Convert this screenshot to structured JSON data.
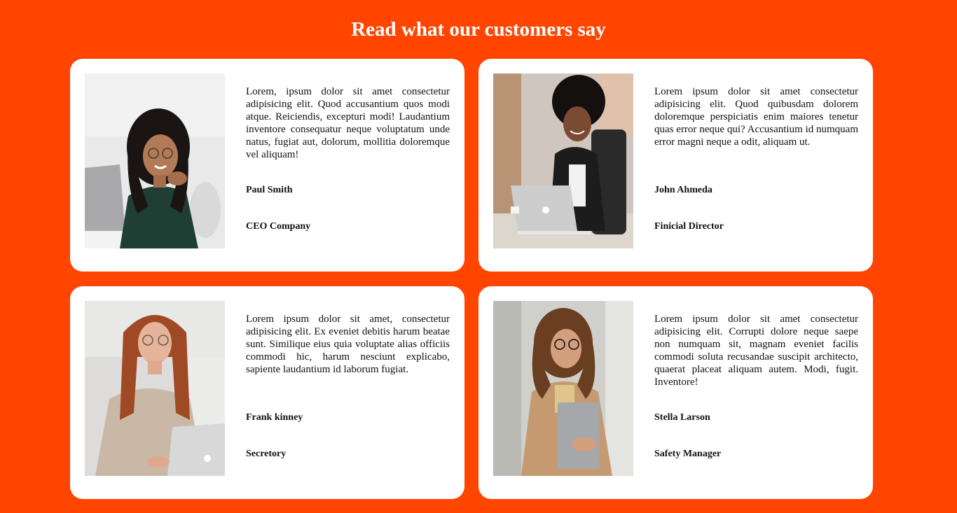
{
  "page": {
    "heading": "Read what our customers say",
    "background_color": "#ff4500"
  },
  "testimonials": [
    {
      "quote": "Lorem, ipsum dolor sit amet consectetur adipisicing elit. Quod accusantium quos modi atque. Reiciendis, excepturi modi! Laudantium inventore consequatur neque voluptatum unde natus, fugiat aut, dolorum, mollitia doloremque vel aliquam!",
      "name": "Paul Smith",
      "role": "CEO Company",
      "photo_icon": "customer-photo"
    },
    {
      "quote": "Lorem ipsum dolor sit amet consectetur adipisicing elit. Quod quibusdam dolorem doloremque perspiciatis enim maiores tenetur quas error neque qui? Accusantium id numquam error magni neque a odit, aliquam ut.",
      "name": "John Ahmeda",
      "role": "Finicial Director",
      "photo_icon": "customer-photo"
    },
    {
      "quote": "Lorem ipsum dolor sit amet, consectetur adipisicing elit. Ex eveniet debitis harum beatae sunt. Similique eius quia voluptate alias officiis commodi hic, harum nesciunt explicabo, sapiente laudantium id laborum fugiat.",
      "name": "Frank kinney",
      "role": "Secretory",
      "photo_icon": "customer-photo"
    },
    {
      "quote": "Lorem ipsum dolor sit amet consectetur adipisicing elit. Corrupti dolore neque saepe non numquam sit, magnam eveniet facilis commodi soluta recusandae suscipit architecto, quaerat placeat aliquam autem. Modi, fugit. Inventore!",
      "name": "Stella Larson",
      "role": "Safety Manager",
      "photo_icon": "customer-photo"
    }
  ]
}
